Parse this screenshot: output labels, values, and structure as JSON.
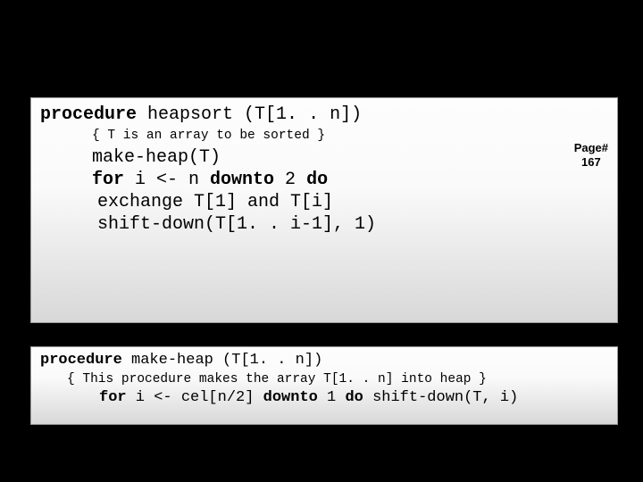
{
  "panel1": {
    "header_kw": "procedure",
    "header_rest": " heapsort (T[1. . n])",
    "comment": "{ T is an array to be sorted }",
    "l1": "make-heap(T)",
    "l2_kw1": "for",
    "l2_mid": " i <- n ",
    "l2_kw2": "downto",
    "l2_rest": " 2 ",
    "l2_kw3": "do",
    "l3": "exchange T[1] and T[i]",
    "l4": "shift-down(T[1. . i-1], 1)",
    "page_label": "Page#",
    "page_num": "167"
  },
  "panel2": {
    "header_kw": "procedure",
    "header_rest": " make-heap (T[1. . n])",
    "comment": "{ This procedure makes the array T[1. . n] into heap }",
    "l1_kw1": "for",
    "l1_mid": " i <- cel[n/2] ",
    "l1_kw2": "downto",
    "l1_mid2": " 1 ",
    "l1_kw3": "do",
    "l1_rest": " shift-down(T, i)"
  }
}
